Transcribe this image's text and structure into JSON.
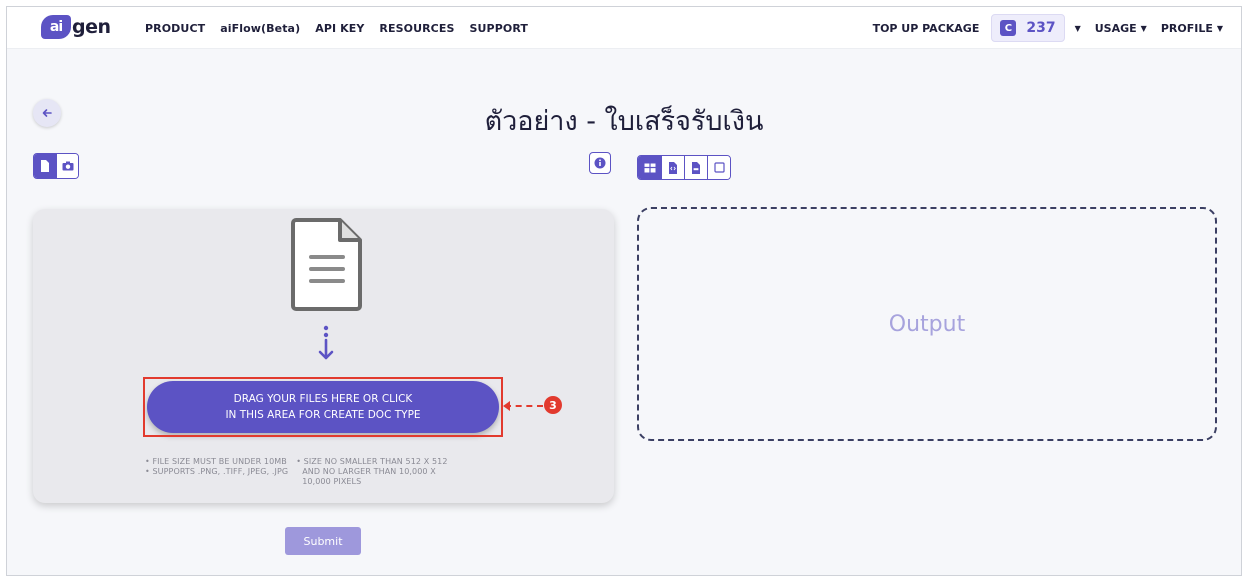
{
  "header": {
    "logo": "aigen",
    "nav": [
      "PRODUCT",
      "aiFlow(Beta)",
      "API KEY",
      "RESOURCES",
      "SUPPORT"
    ],
    "topup_label": "TOP UP PACKAGE",
    "credit_icon": "C",
    "credit_value": "237",
    "usage_label": "USAGE",
    "profile_label": "PROFILE"
  },
  "page": {
    "title": "ตัวอย่าง - ใบเสร็จรับเงิน"
  },
  "upload": {
    "button_line1": "DRAG YOUR FILES HERE OR CLICK",
    "button_line2": "IN THIS AREA FOR CREATE DOC TYPE",
    "rules_col1": [
      "• FILE SIZE MUST BE UNDER 10MB",
      "• SUPPORTS .PNG, .TIFF, JPEG, .JPG"
    ],
    "rules_col2": [
      "• SIZE NO SMALLER THAN 512 X 512",
      "AND NO LARGER THAN 10,000 X",
      "10,000 PIXELS"
    ]
  },
  "annotation": {
    "step": "3"
  },
  "output": {
    "placeholder": "Output"
  },
  "actions": {
    "submit_label": "Submit"
  },
  "colors": {
    "accent": "#5c53c4",
    "annotation": "#e23a2e"
  }
}
